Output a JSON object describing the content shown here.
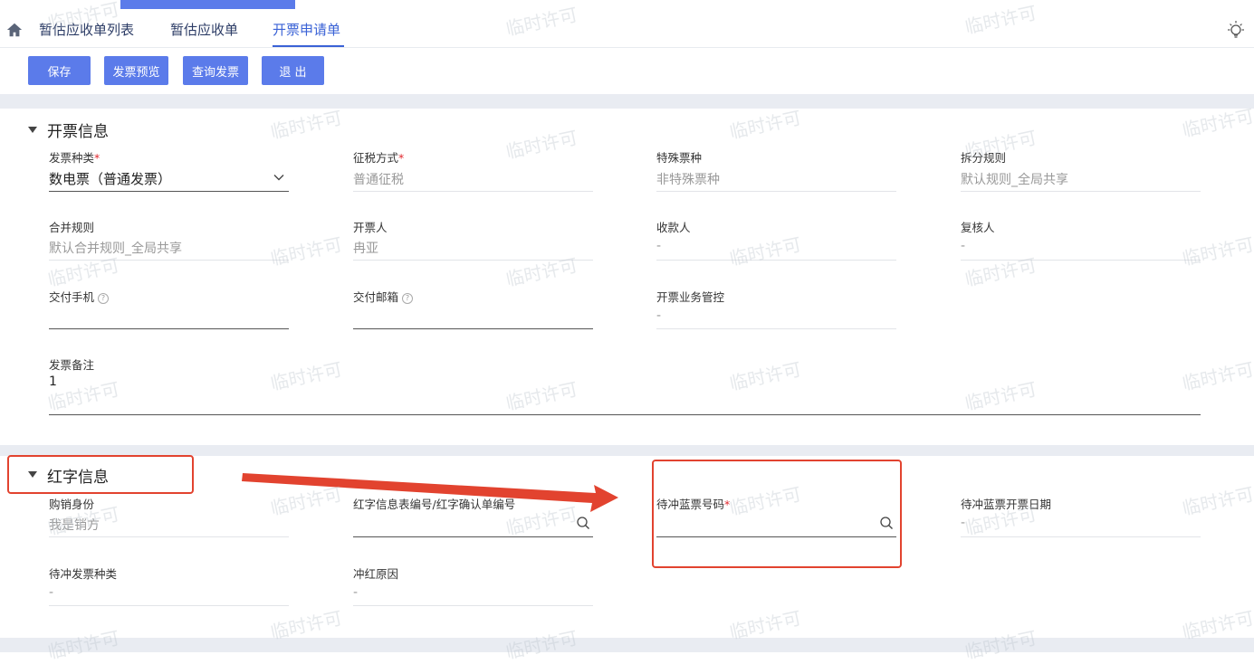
{
  "nav": {
    "tabs": [
      {
        "label": "暂估应收单列表"
      },
      {
        "label": "暂估应收单"
      },
      {
        "label": "开票申请单"
      }
    ]
  },
  "toolbar": {
    "save": "保存",
    "preview": "发票预览",
    "query": "查询发票",
    "exit": "退 出"
  },
  "invoice_info": {
    "title": "开票信息",
    "invoice_type": {
      "label": "发票种类",
      "value": "数电票（普通发票）"
    },
    "tax_method": {
      "label": "征税方式",
      "value": "普通征税"
    },
    "special_ticket": {
      "label": "特殊票种",
      "value": "非特殊票种"
    },
    "split_rule": {
      "label": "拆分规则",
      "value": "默认规则_全局共享"
    },
    "merge_rule": {
      "label": "合并规则",
      "value": "默认合并规则_全局共享"
    },
    "issuer": {
      "label": "开票人",
      "value": "冉亚"
    },
    "payee": {
      "label": "收款人",
      "value": "-"
    },
    "reviewer": {
      "label": "复核人",
      "value": "-"
    },
    "delivery_phone": {
      "label": "交付手机",
      "value": ""
    },
    "delivery_email": {
      "label": "交付邮箱",
      "value": ""
    },
    "business_control": {
      "label": "开票业务管控",
      "value": "-"
    },
    "remark": {
      "label": "发票备注",
      "value": "1"
    }
  },
  "red_info": {
    "title": "红字信息",
    "identity": {
      "label": "购销身份",
      "value": "我是销方"
    },
    "red_no": {
      "label": "红字信息表编号/红字确认单编号",
      "value": ""
    },
    "blue_no": {
      "label": "待冲蓝票号码",
      "value": ""
    },
    "blue_date": {
      "label": "待冲蓝票开票日期",
      "value": "-"
    },
    "pending_type": {
      "label": "待冲发票种类",
      "value": "-"
    },
    "reason": {
      "label": "冲红原因",
      "value": "-"
    }
  },
  "watermark": "临时许可",
  "colors": {
    "primary": "#5b7bea",
    "annotation": "#e2432f",
    "required": "#e0282e"
  }
}
